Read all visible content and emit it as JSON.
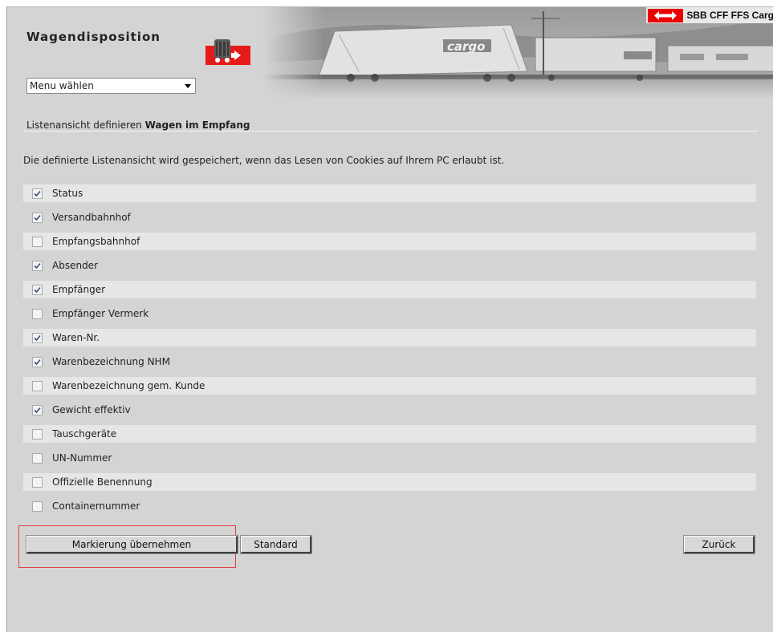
{
  "header": {
    "app_title": "Wagendisposition",
    "brand_text": "SBB CFF FFS Carg",
    "banner_wagon_text": "cargo",
    "brand_color": "#eb0000"
  },
  "menu": {
    "selected": "Menu wählen"
  },
  "section": {
    "prefix": "Listenansicht definieren",
    "name": "Wagen im Empfang"
  },
  "info_text": "Die definierte Listenansicht wird gespeichert, wenn das Lesen von Cookies auf Ihrem PC erlaubt ist.",
  "columns": [
    {
      "label": "Status",
      "checked": true
    },
    {
      "label": "Versandbahnhof",
      "checked": true
    },
    {
      "label": "Empfangsbahnhof",
      "checked": false
    },
    {
      "label": "Absender",
      "checked": true
    },
    {
      "label": "Empfänger",
      "checked": true
    },
    {
      "label": "Empfänger Vermerk",
      "checked": false
    },
    {
      "label": "Waren-Nr.",
      "checked": true
    },
    {
      "label": "Warenbezeichnung NHM",
      "checked": true
    },
    {
      "label": "Warenbezeichnung gem. Kunde",
      "checked": false
    },
    {
      "label": "Gewicht effektiv",
      "checked": true
    },
    {
      "label": "Tauschgeräte",
      "checked": false
    },
    {
      "label": "UN-Nummer",
      "checked": false
    },
    {
      "label": "Offizielle Benennung",
      "checked": false
    },
    {
      "label": "Containernummer",
      "checked": false
    }
  ],
  "buttons": {
    "apply": "Markierung übernehmen",
    "standard": "Standard",
    "back": "Zurück"
  }
}
